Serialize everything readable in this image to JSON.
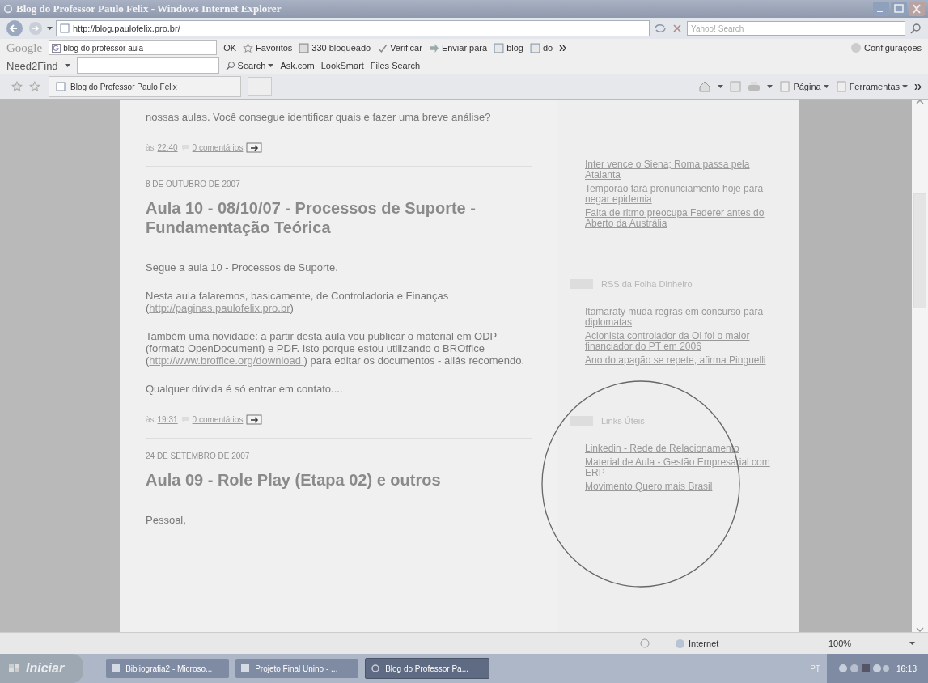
{
  "window": {
    "title": "Blog do Professor Paulo Felix - Windows Internet Explorer"
  },
  "address_bar": {
    "url": "http://blog.paulofelix.pro.br/",
    "search_placeholder": "Yahoo! Search"
  },
  "google_toolbar": {
    "brand": "Google",
    "query": "blog do professor aula",
    "items": [
      {
        "label": "OK",
        "kind": "text"
      },
      {
        "label": "Favoritos",
        "kind": "star"
      },
      {
        "label": "330 bloqueado",
        "kind": "popup"
      },
      {
        "label": "Verificar",
        "kind": "spell"
      },
      {
        "label": "Enviar para",
        "kind": "send"
      },
      {
        "label": "blog",
        "kind": "doc"
      },
      {
        "label": "do",
        "kind": "doc"
      }
    ],
    "settings": "Configurações"
  },
  "need2find_toolbar": {
    "brand": "Need2Find",
    "search": "Search",
    "links": [
      "Ask.com",
      "LookSmart",
      "Files Search"
    ]
  },
  "tabs": [
    {
      "label": "Blog do Professor Paulo Felix",
      "selected": true
    }
  ],
  "commands": [
    "Página",
    "Ferramentas"
  ],
  "posts": [
    {
      "body": [
        [
          {
            "text": "nossas aulas. Você consegue identificar quais e fazer uma breve análise?"
          }
        ]
      ],
      "at": "às",
      "time": "22:40",
      "comments": "0 comentários"
    },
    {
      "date": "8 DE OUTUBRO DE 2007",
      "title": "Aula 10 - 08/10/07 - Processos de Suporte - Fundamentação Teórica",
      "body": [
        [
          {
            "text": "Segue a aula 10 - Processos de Suporte."
          }
        ],
        [
          {
            "text": "Nesta aula falaremos, basicamente, de Controladoria e Finanças ("
          },
          {
            "link": "http://paginas.paulofelix.pro.br"
          },
          {
            "text": ")"
          }
        ],
        [
          {
            "text": "Também uma novidade: a partir desta aula vou publicar o material em ODP (formato OpenDocument) e PDF. Isto porque estou utilizando o BROffice ("
          },
          {
            "link": "http://www.broffice.org/download "
          },
          {
            "text": ") para editar os documentos - aliás recomendo."
          }
        ],
        [
          {
            "text": "Qualquer dúvida é só entrar em contato...."
          }
        ]
      ],
      "at": "às",
      "time": "19:31",
      "comments": "0 comentários"
    },
    {
      "date": "24 DE SETEMBRO DE 2007",
      "title": "Aula 09 - Role Play (Etapa 02) e outros",
      "body": [
        [
          {
            "text": "Pessoal,"
          }
        ]
      ]
    }
  ],
  "sidebar": [
    {
      "links": [
        "Inter vence o Siena; Roma passa pela Atalanta",
        "Temporão fará pronunciamento hoje para negar epidemia",
        "Falta de ritmo preocupa Federer antes do Aberto da Austrália"
      ]
    },
    {
      "heading": "RSS da Folha Dinheiro",
      "links": [
        "Itamaraty muda regras em concurso para diplomatas",
        "Acionista controlador da Oi foi o maior financiador do PT em 2006",
        "Ano do apagão se repete, afirma Pinguelli"
      ]
    },
    {
      "heading": "Links Úteis",
      "links": [
        "Linkedin - Rede de Relacionamento",
        "Material de Aula - Gestão Empresarial com ERP",
        "Movimento Quero mais Brasil"
      ]
    }
  ],
  "status_bar": {
    "zone": "Internet",
    "zoom": "100%"
  },
  "taskbar": {
    "start": "Iniciar",
    "tasks": [
      {
        "label": "Bibliografia2 - Microso...",
        "kind": "doc",
        "selected": false
      },
      {
        "label": "Projeto Final Unino - ...",
        "kind": "doc",
        "selected": false
      },
      {
        "label": "Blog do Professor Pa...",
        "kind": "ie",
        "selected": true
      }
    ],
    "language": "PT",
    "clock": "16:13"
  }
}
